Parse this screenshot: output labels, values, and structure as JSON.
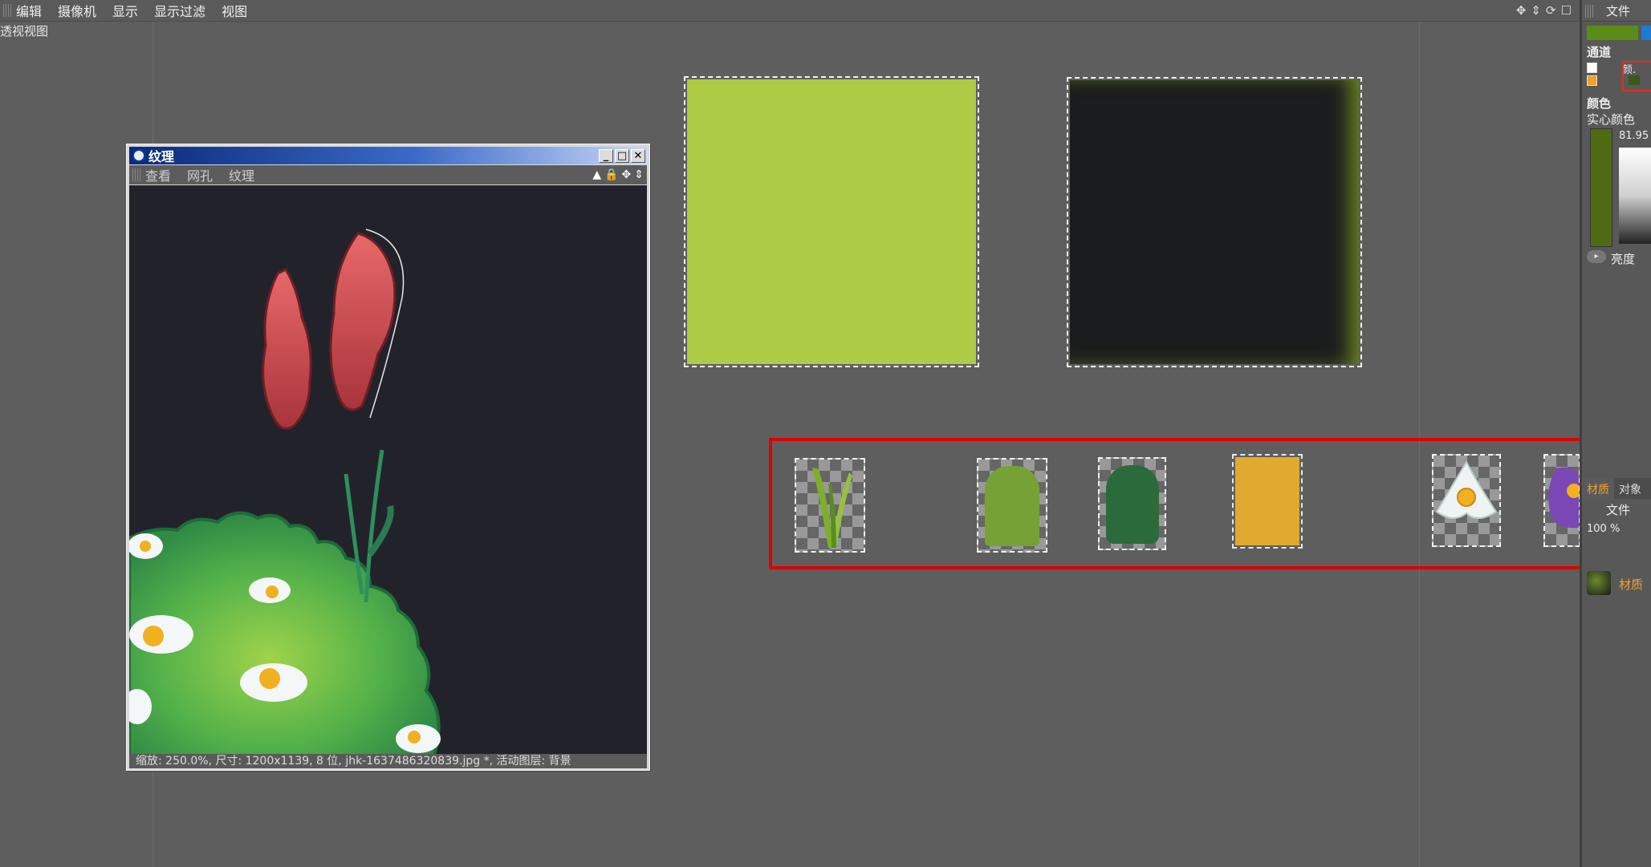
{
  "menubar": {
    "items": [
      "编辑",
      "摄像机",
      "显示",
      "显示过滤",
      "视图"
    ],
    "tool_icons": [
      "move-icon",
      "zoom-icon",
      "rotate-icon",
      "maximize-icon"
    ]
  },
  "viewport": {
    "label": "透视视图"
  },
  "texture_window": {
    "title": "纹理",
    "menu": [
      "查看",
      "网孔",
      "纹理"
    ],
    "window_buttons": [
      "_",
      "□",
      "✕"
    ],
    "status": "缩放: 250.0%, 尺寸: 1200x1139, 8 位, jhk-1637486320839.jpg *, 活动图层: 背景"
  },
  "swatches": {
    "large": [
      {
        "name": "light-green-texture",
        "color": "#aecb45"
      },
      {
        "name": "dark-texture",
        "color": "#1b1c1d"
      }
    ],
    "small": [
      {
        "name": "grass-blades",
        "color": "#86b02e"
      },
      {
        "name": "medium-green",
        "color": "#76a135"
      },
      {
        "name": "dark-green",
        "color": "#2b6a3b"
      },
      {
        "name": "orange-yellow",
        "color": "#e0aa2e"
      },
      {
        "name": "white-flower",
        "color": "#eef3f3"
      },
      {
        "name": "purple-flower",
        "color": "#7a47b5"
      }
    ],
    "highlight_color": "#e00000"
  },
  "right_panel": {
    "file_label": "文件",
    "channel_label": "通道",
    "channel_value": "颜.",
    "color_label": "颜色",
    "solid_color": "实心颜色",
    "value": "81.95",
    "brightness": "亮度",
    "tab_material": "材质",
    "tab_object": "对象",
    "file_label_2": "文件",
    "zoom": "100 %",
    "material_label": "材质"
  }
}
